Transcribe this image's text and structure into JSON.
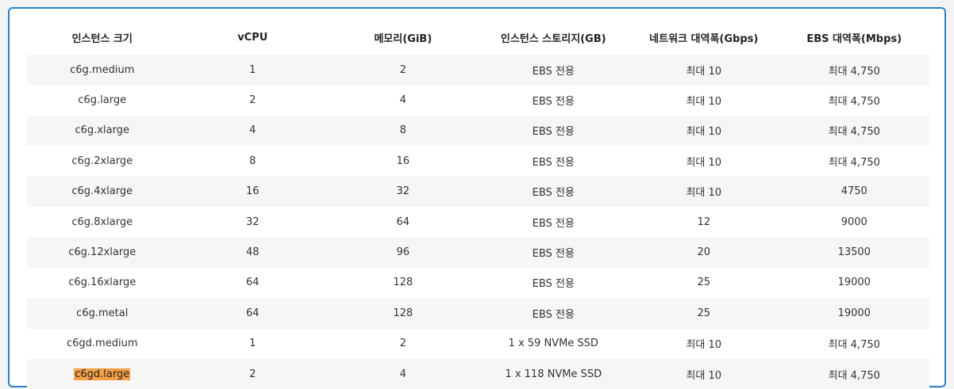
{
  "table": {
    "headers": [
      "인스턴스 크기",
      "vCPU",
      "메모리(GiB)",
      "인스턴스 스토리지(GB)",
      "네트워크 대역폭(Gbps)",
      "EBS 대역폭(Mbps)"
    ],
    "rows": [
      [
        "c6g.medium",
        "1",
        "2",
        "EBS 전용",
        "최대 10",
        "최대 4,750"
      ],
      [
        "c6g.large",
        "2",
        "4",
        "EBS 전용",
        "최대 10",
        "최대 4,750"
      ],
      [
        "c6g.xlarge",
        "4",
        "8",
        "EBS 전용",
        "최대 10",
        "최대 4,750"
      ],
      [
        "c6g.2xlarge",
        "8",
        "16",
        "EBS 전용",
        "최대 10",
        "최대 4,750"
      ],
      [
        "c6g.4xlarge",
        "16",
        "32",
        "EBS 전용",
        "최대 10",
        "4750"
      ],
      [
        "c6g.8xlarge",
        "32",
        "64",
        "EBS 전용",
        "12",
        "9000"
      ],
      [
        "c6g.12xlarge",
        "48",
        "96",
        "EBS 전용",
        "20",
        "13500"
      ],
      [
        "c6g.16xlarge",
        "64",
        "128",
        "EBS 전용",
        "25",
        "19000"
      ],
      [
        "c6g.metal",
        "64",
        "128",
        "EBS 전용",
        "25",
        "19000"
      ],
      [
        "c6gd.medium",
        "1",
        "2",
        "1 x 59 NVMe SSD",
        "최대 10",
        "최대 4,750"
      ],
      [
        "c6gd.large",
        "2",
        "4",
        "1 x 118 NVMe SSD",
        "최대 10",
        "최대 4,750"
      ]
    ],
    "highlighted_cell": "c6gd.large",
    "highlight_color": "#f7a046",
    "border_color": "#2f7fc1"
  }
}
